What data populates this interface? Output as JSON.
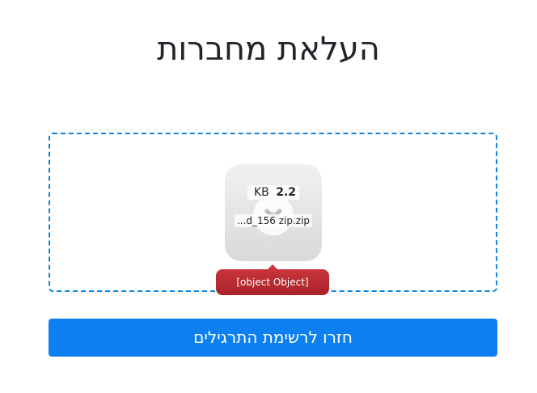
{
  "page": {
    "title": "העלאת מחברות"
  },
  "dropzone": {
    "border_color": "#0d86e3",
    "file": {
      "size_value": "2.2",
      "size_unit": "KB",
      "name": "...d_156 zip.zip",
      "icon": "remove-x-icon"
    },
    "error_message": "[object Object]",
    "error_color": "#b52b30"
  },
  "actions": {
    "back_label": "חזרו לרשימת התרגילים",
    "back_color": "#0d7ff0"
  }
}
